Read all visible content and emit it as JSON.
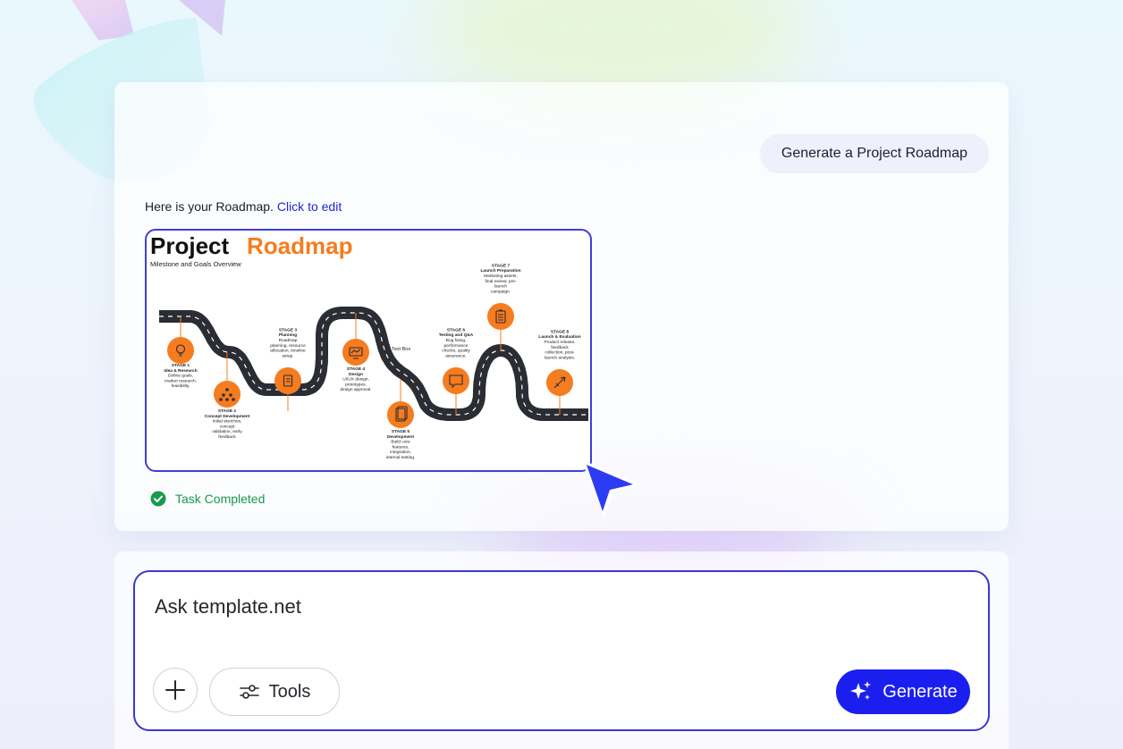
{
  "user_message": "Generate a Project Roadmap",
  "reply": {
    "text": "Here is your Roadmap.",
    "link": "Click to edit"
  },
  "roadmap": {
    "title_word1": "Project",
    "title_word2": "Roadmap",
    "subtitle": "Milestone and Goals Overview",
    "textbox_label": "Text Box",
    "stages": [
      {
        "number": "STAGE 1",
        "name": "Idea & Research",
        "desc": [
          "Define goals,",
          "market research,",
          "feasibility."
        ]
      },
      {
        "number": "STAGE 2",
        "name": "Concept Development",
        "desc": [
          "Initial sketches,",
          "concept",
          "validation, early",
          "feedback"
        ]
      },
      {
        "number": "STAGE 3",
        "name": "Planning",
        "desc": [
          "Roadmap",
          "planning, resource",
          "allocation, timeline",
          "setup."
        ]
      },
      {
        "number": "STAGE 4",
        "name": "Design",
        "desc": [
          "UI/UX design,",
          "prototypes,",
          "design approval."
        ]
      },
      {
        "number": "STAGE 5",
        "name": "Development",
        "desc": [
          "Build core",
          "features,",
          "integration,",
          "internal testing."
        ]
      },
      {
        "number": "STAGE 6",
        "name": "Testing and Q&A",
        "desc": [
          "Bug fixing,",
          "performance",
          "checks, quality",
          "assurance."
        ]
      },
      {
        "number": "STAGE 7",
        "name": "Launch Preparation",
        "desc": [
          "Marketing assets,",
          "final review, pre-",
          "launch",
          "campaign."
        ]
      },
      {
        "number": "STAGE 8",
        "name": "Launch & Evaluation",
        "desc": [
          "Product release,",
          "feedback",
          "collection, post-",
          "launch analysis."
        ]
      }
    ]
  },
  "status": "Task Completed",
  "composer": {
    "placeholder": "Ask template.net",
    "tools_label": "Tools",
    "generate_label": "Generate"
  },
  "colors": {
    "accent": "#1a1ff0",
    "border": "#3d3fd6",
    "orange": "#f57c1f",
    "success": "#1a9a4c"
  }
}
